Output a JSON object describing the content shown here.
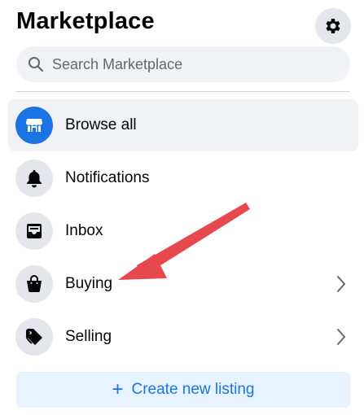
{
  "header": {
    "title": "Marketplace"
  },
  "search": {
    "placeholder": "Search Marketplace"
  },
  "nav": {
    "items": [
      {
        "label": "Browse all",
        "icon": "storefront-icon",
        "active": true
      },
      {
        "label": "Notifications",
        "icon": "bell-icon"
      },
      {
        "label": "Inbox",
        "icon": "inbox-icon"
      },
      {
        "label": "Buying",
        "icon": "shopping-bag-icon",
        "has_chevron": true
      },
      {
        "label": "Selling",
        "icon": "price-tag-icon",
        "has_chevron": true
      }
    ]
  },
  "create_listing": {
    "label": "Create new listing"
  },
  "colors": {
    "accent": "#1b74e4",
    "annotation_arrow": "#e5484d"
  }
}
